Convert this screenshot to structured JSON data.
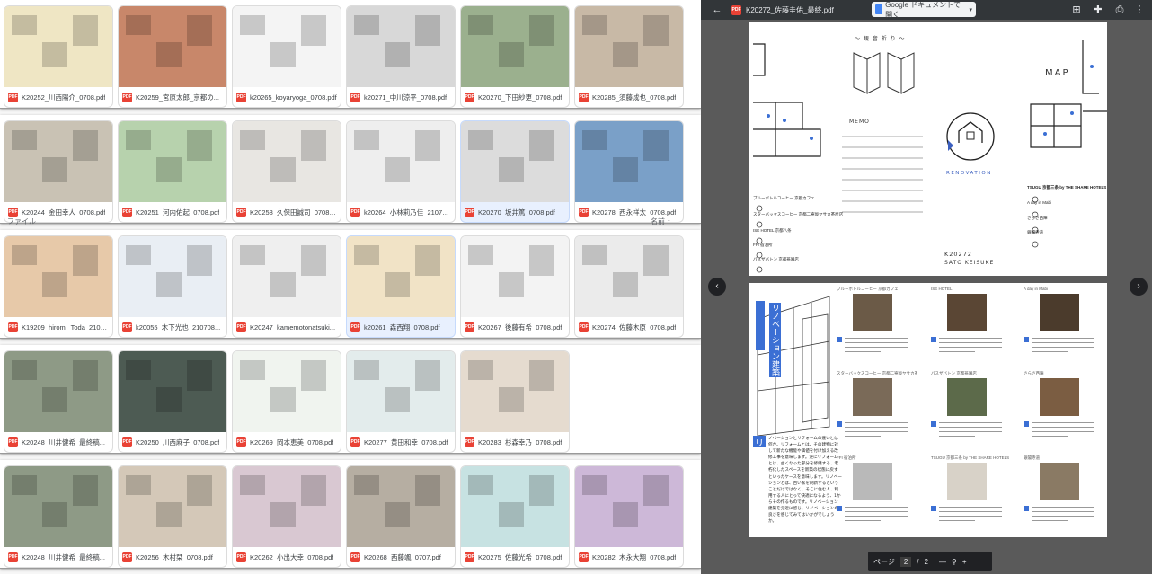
{
  "drive": {
    "header_labels": {
      "file": "ファイル",
      "name": "名前"
    },
    "rows": [
      {
        "items": [
          {
            "name": "K20252_川西陽介_0708.pdf",
            "color": "#efe6c4"
          },
          {
            "name": "K20259_宮原太郎_京都の...",
            "color": "#c8876a"
          },
          {
            "name": "k20265_koyaryoga_0708.pdf",
            "color": "#f4f4f4"
          },
          {
            "name": "k20271_中川涼平_0708.pdf",
            "color": "#d8d8d8"
          },
          {
            "name": "K20270_下田紗更_0708.pdf",
            "color": "#9bb08e"
          },
          {
            "name": "K20285_須藤成也_0708.pdf",
            "color": "#c8b9a6"
          }
        ]
      },
      {
        "items": [
          {
            "name": "K20244_金田幸人_0708.pdf",
            "color": "#c9c2b4"
          },
          {
            "name": "K20251_河内佑起_0708.pdf",
            "color": "#b7d2ad"
          },
          {
            "name": "K20258_久保田誠司_0708.pdf",
            "color": "#e8e6e2"
          },
          {
            "name": "k20264_小林莉乃佳_21070...",
            "color": "#eeeeee"
          },
          {
            "name": "K20270_坂井篤_0708.pdf",
            "color": "#dcdcdc",
            "selected": true
          },
          {
            "name": "K20278_西永祥太_0708.pdf",
            "color": "#7aa0c8"
          }
        ]
      },
      {
        "items": [
          {
            "name": "K19209_hiromi_Toda_2107...",
            "color": "#e7c9a9"
          },
          {
            "name": "k20055_木下光也_210708...",
            "color": "#e9eef4"
          },
          {
            "name": "K20247_kamemotonatsuki...",
            "color": "#efefef"
          },
          {
            "name": "k20261_森西翔_0708.pdf",
            "color": "#f1e3c6",
            "selected": true
          },
          {
            "name": "K20267_後藤有希_0708.pdf",
            "color": "#f3f3f3"
          },
          {
            "name": "K20274_佐藤木原_0708.pdf",
            "color": "#ebebeb"
          }
        ]
      },
      {
        "items": [
          {
            "name": "K20248_川井健希_最終稿...",
            "color": "#8e9a86"
          },
          {
            "name": "K20250_川西麻子_0708.pdf",
            "color": "#4d5b53"
          },
          {
            "name": "K20269_岡本恵美_0708.pdf",
            "color": "#f0f4ef"
          },
          {
            "name": "K20277_黄田和幸_0708.pdf",
            "color": "#e3ecec"
          },
          {
            "name": "K20283_杉森幸乃_0708.pdf",
            "color": "#e5dbcf"
          }
        ]
      },
      {
        "items": [
          {
            "name": "K20248_川井健希_最終稿...",
            "color": "#8e9a86"
          },
          {
            "name": "K20256_木村栞_0708.pdf",
            "color": "#d4c8b8"
          },
          {
            "name": "K20262_小出大幸_0708.pdf",
            "color": "#d9c8d2"
          },
          {
            "name": "K20268_西藤颯_0707.pdf",
            "color": "#b6aea2"
          },
          {
            "name": "K20275_佐藤光希_0708.pdf",
            "color": "#c7e2e2"
          },
          {
            "name": "K20282_木永大翔_0708.pdf",
            "color": "#cdb8d8"
          }
        ]
      }
    ]
  },
  "viewer": {
    "file_title": "K20272_佐藤圭佑_最終.pdf",
    "open_button": "Google ドキュメントで開く",
    "pager": {
      "label": "ページ",
      "current": "2",
      "separator": "/",
      "total": "2"
    },
    "page1": {
      "fold_title": "～ 観 音 折 り ～",
      "map_title": "MAP",
      "memo_title": "MEMO",
      "renovation": "RENOVATION",
      "code": "K20272",
      "author": "SATO KEISUKE",
      "left_list": [
        "ブルーボトルコーヒー 京都カフェ",
        "スターバックスコーヒー 京都二寧坂ヤサカ茶屋店",
        "ISE HOTEL 京都八条",
        "FFI 宿泊所",
        "パスザバトン 京都祇園店"
      ],
      "right_list": [
        "TSUGU 京都三条 by THE SHARE HOTELS",
        "A day in Mabi",
        "さらさ西陣",
        "銀閣寺道"
      ]
    },
    "page2": {
      "vertical_title": "リノベーション建築",
      "lead_initial": "リ",
      "body_text": "ノベーションとリフォームの違いとは何か。リフォームとは、その建物に対して新たな機能や価値を付け加える改修工事を意味します。逆にリフォームとは、古くなった部分を修繕する、老朽化したスペースを新築の状態に戻すといったケースを意味します。リノベーションとは、古い家を刷新するということだけではなく、そこに住む人、利用する人にとって快適になるよう、1からその作るものです。リノベーション建築を身近に感じ、リノベーションの良さを感じてみてはいかがでしょうか。",
      "shop_titles": [
        "ブルーボトルコーヒー 京都カフェ",
        "ISE HOTEL",
        "A day in Mabi",
        "スターバックスコーヒー 京都二寧坂ヤサカ茶屋店",
        "パスザバトン 京都祇園店",
        "さらさ西陣",
        "FFI 宿泊所",
        "TSUGU 京都三条 by THE SHARE HOTELS",
        "銀閣寺道"
      ]
    }
  }
}
